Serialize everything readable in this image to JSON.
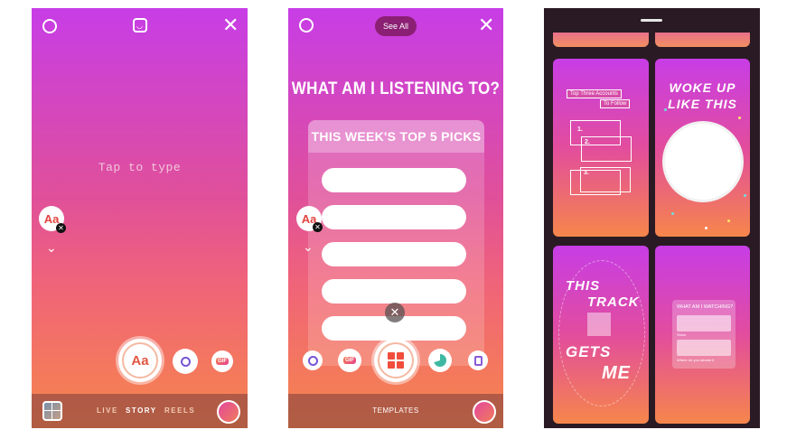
{
  "screen1": {
    "placeholder": "Tap to type",
    "aa_label": "Aa",
    "shutter_label": "Aa",
    "gif_label": "GIF",
    "tabs": [
      "LIVE",
      "STORY",
      "REELS"
    ],
    "active_tab": "STORY"
  },
  "screen2": {
    "see_all": "See All",
    "title": "WHAT AM I LISTENING TO?",
    "card_header": "THIS WEEK'S TOP 5 PICKS",
    "aa_label": "Aa",
    "gif_label": "GIF",
    "templates_label": "TEMPLATES"
  },
  "screen3": {
    "tile_a": {
      "header": "Top Three Accounts",
      "subheader": "To Follow",
      "numbers": [
        "1.",
        "2.",
        "3."
      ]
    },
    "tile_b": {
      "line1": "WOKE UP",
      "line2": "LIKE THIS"
    },
    "tile_c": {
      "line1": "THIS",
      "line2": "TRACK",
      "line3": "GETS",
      "line4": "ME"
    },
    "tile_d": {
      "title": "WHAT AM I WATCHING?",
      "field1": "Show",
      "field2": "Where do you stream it"
    }
  },
  "colors": {
    "gradient_top": "#c73de6",
    "gradient_mid": "#e0509a",
    "gradient_bottom": "#f6864b",
    "accent_red": "#e2443f"
  }
}
